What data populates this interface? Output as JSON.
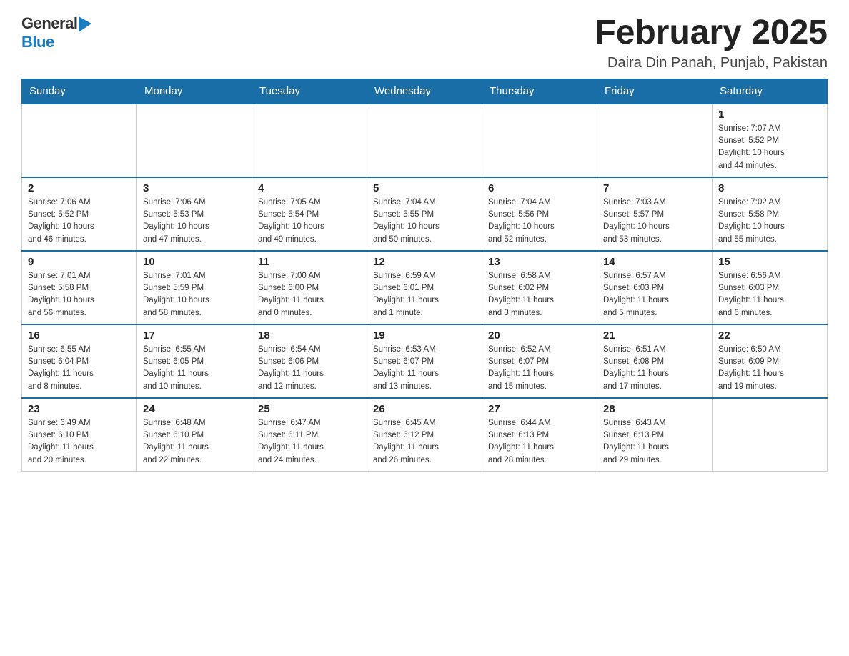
{
  "header": {
    "logo_text1": "General",
    "logo_text2": "Blue",
    "calendar_title": "February 2025",
    "calendar_subtitle": "Daira Din Panah, Punjab, Pakistan"
  },
  "weekdays": [
    "Sunday",
    "Monday",
    "Tuesday",
    "Wednesday",
    "Thursday",
    "Friday",
    "Saturday"
  ],
  "weeks": [
    [
      {
        "day": "",
        "info": ""
      },
      {
        "day": "",
        "info": ""
      },
      {
        "day": "",
        "info": ""
      },
      {
        "day": "",
        "info": ""
      },
      {
        "day": "",
        "info": ""
      },
      {
        "day": "",
        "info": ""
      },
      {
        "day": "1",
        "info": "Sunrise: 7:07 AM\nSunset: 5:52 PM\nDaylight: 10 hours\nand 44 minutes."
      }
    ],
    [
      {
        "day": "2",
        "info": "Sunrise: 7:06 AM\nSunset: 5:52 PM\nDaylight: 10 hours\nand 46 minutes."
      },
      {
        "day": "3",
        "info": "Sunrise: 7:06 AM\nSunset: 5:53 PM\nDaylight: 10 hours\nand 47 minutes."
      },
      {
        "day": "4",
        "info": "Sunrise: 7:05 AM\nSunset: 5:54 PM\nDaylight: 10 hours\nand 49 minutes."
      },
      {
        "day": "5",
        "info": "Sunrise: 7:04 AM\nSunset: 5:55 PM\nDaylight: 10 hours\nand 50 minutes."
      },
      {
        "day": "6",
        "info": "Sunrise: 7:04 AM\nSunset: 5:56 PM\nDaylight: 10 hours\nand 52 minutes."
      },
      {
        "day": "7",
        "info": "Sunrise: 7:03 AM\nSunset: 5:57 PM\nDaylight: 10 hours\nand 53 minutes."
      },
      {
        "day": "8",
        "info": "Sunrise: 7:02 AM\nSunset: 5:58 PM\nDaylight: 10 hours\nand 55 minutes."
      }
    ],
    [
      {
        "day": "9",
        "info": "Sunrise: 7:01 AM\nSunset: 5:58 PM\nDaylight: 10 hours\nand 56 minutes."
      },
      {
        "day": "10",
        "info": "Sunrise: 7:01 AM\nSunset: 5:59 PM\nDaylight: 10 hours\nand 58 minutes."
      },
      {
        "day": "11",
        "info": "Sunrise: 7:00 AM\nSunset: 6:00 PM\nDaylight: 11 hours\nand 0 minutes."
      },
      {
        "day": "12",
        "info": "Sunrise: 6:59 AM\nSunset: 6:01 PM\nDaylight: 11 hours\nand 1 minute."
      },
      {
        "day": "13",
        "info": "Sunrise: 6:58 AM\nSunset: 6:02 PM\nDaylight: 11 hours\nand 3 minutes."
      },
      {
        "day": "14",
        "info": "Sunrise: 6:57 AM\nSunset: 6:03 PM\nDaylight: 11 hours\nand 5 minutes."
      },
      {
        "day": "15",
        "info": "Sunrise: 6:56 AM\nSunset: 6:03 PM\nDaylight: 11 hours\nand 6 minutes."
      }
    ],
    [
      {
        "day": "16",
        "info": "Sunrise: 6:55 AM\nSunset: 6:04 PM\nDaylight: 11 hours\nand 8 minutes."
      },
      {
        "day": "17",
        "info": "Sunrise: 6:55 AM\nSunset: 6:05 PM\nDaylight: 11 hours\nand 10 minutes."
      },
      {
        "day": "18",
        "info": "Sunrise: 6:54 AM\nSunset: 6:06 PM\nDaylight: 11 hours\nand 12 minutes."
      },
      {
        "day": "19",
        "info": "Sunrise: 6:53 AM\nSunset: 6:07 PM\nDaylight: 11 hours\nand 13 minutes."
      },
      {
        "day": "20",
        "info": "Sunrise: 6:52 AM\nSunset: 6:07 PM\nDaylight: 11 hours\nand 15 minutes."
      },
      {
        "day": "21",
        "info": "Sunrise: 6:51 AM\nSunset: 6:08 PM\nDaylight: 11 hours\nand 17 minutes."
      },
      {
        "day": "22",
        "info": "Sunrise: 6:50 AM\nSunset: 6:09 PM\nDaylight: 11 hours\nand 19 minutes."
      }
    ],
    [
      {
        "day": "23",
        "info": "Sunrise: 6:49 AM\nSunset: 6:10 PM\nDaylight: 11 hours\nand 20 minutes."
      },
      {
        "day": "24",
        "info": "Sunrise: 6:48 AM\nSunset: 6:10 PM\nDaylight: 11 hours\nand 22 minutes."
      },
      {
        "day": "25",
        "info": "Sunrise: 6:47 AM\nSunset: 6:11 PM\nDaylight: 11 hours\nand 24 minutes."
      },
      {
        "day": "26",
        "info": "Sunrise: 6:45 AM\nSunset: 6:12 PM\nDaylight: 11 hours\nand 26 minutes."
      },
      {
        "day": "27",
        "info": "Sunrise: 6:44 AM\nSunset: 6:13 PM\nDaylight: 11 hours\nand 28 minutes."
      },
      {
        "day": "28",
        "info": "Sunrise: 6:43 AM\nSunset: 6:13 PM\nDaylight: 11 hours\nand 29 minutes."
      },
      {
        "day": "",
        "info": ""
      }
    ]
  ]
}
